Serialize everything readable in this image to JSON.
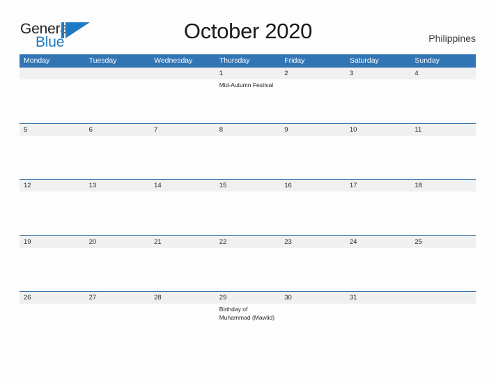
{
  "header": {
    "logo": {
      "word_one": "General",
      "word_two": "Blue",
      "triangle_color": "#1f7ac4"
    },
    "month_title": "October 2020",
    "locale": "Philippines"
  },
  "theme": {
    "header_blue": "#3175b5",
    "row_divider_blue": "#2e6da4",
    "daynum_band_gray": "#f0f0f0",
    "page_background": "#fdfdfd",
    "text_dark": "#252525"
  },
  "calendar": {
    "weekdays": [
      "Monday",
      "Tuesday",
      "Wednesday",
      "Thursday",
      "Friday",
      "Saturday",
      "Sunday"
    ],
    "weeks": [
      {
        "days": [
          {
            "num": "",
            "event": ""
          },
          {
            "num": "",
            "event": ""
          },
          {
            "num": "",
            "event": ""
          },
          {
            "num": "1",
            "event": "Mid-Autumn Festival"
          },
          {
            "num": "2",
            "event": ""
          },
          {
            "num": "3",
            "event": ""
          },
          {
            "num": "4",
            "event": ""
          }
        ]
      },
      {
        "days": [
          {
            "num": "5",
            "event": ""
          },
          {
            "num": "6",
            "event": ""
          },
          {
            "num": "7",
            "event": ""
          },
          {
            "num": "8",
            "event": ""
          },
          {
            "num": "9",
            "event": ""
          },
          {
            "num": "10",
            "event": ""
          },
          {
            "num": "11",
            "event": ""
          }
        ]
      },
      {
        "days": [
          {
            "num": "12",
            "event": ""
          },
          {
            "num": "13",
            "event": ""
          },
          {
            "num": "14",
            "event": ""
          },
          {
            "num": "15",
            "event": ""
          },
          {
            "num": "16",
            "event": ""
          },
          {
            "num": "17",
            "event": ""
          },
          {
            "num": "18",
            "event": ""
          }
        ]
      },
      {
        "days": [
          {
            "num": "19",
            "event": ""
          },
          {
            "num": "20",
            "event": ""
          },
          {
            "num": "21",
            "event": ""
          },
          {
            "num": "22",
            "event": ""
          },
          {
            "num": "23",
            "event": ""
          },
          {
            "num": "24",
            "event": ""
          },
          {
            "num": "25",
            "event": ""
          }
        ]
      },
      {
        "days": [
          {
            "num": "26",
            "event": ""
          },
          {
            "num": "27",
            "event": ""
          },
          {
            "num": "28",
            "event": ""
          },
          {
            "num": "29",
            "event": "Birthday of Muhammad (Mawlid)"
          },
          {
            "num": "30",
            "event": ""
          },
          {
            "num": "31",
            "event": ""
          },
          {
            "num": "",
            "event": ""
          }
        ]
      }
    ]
  }
}
